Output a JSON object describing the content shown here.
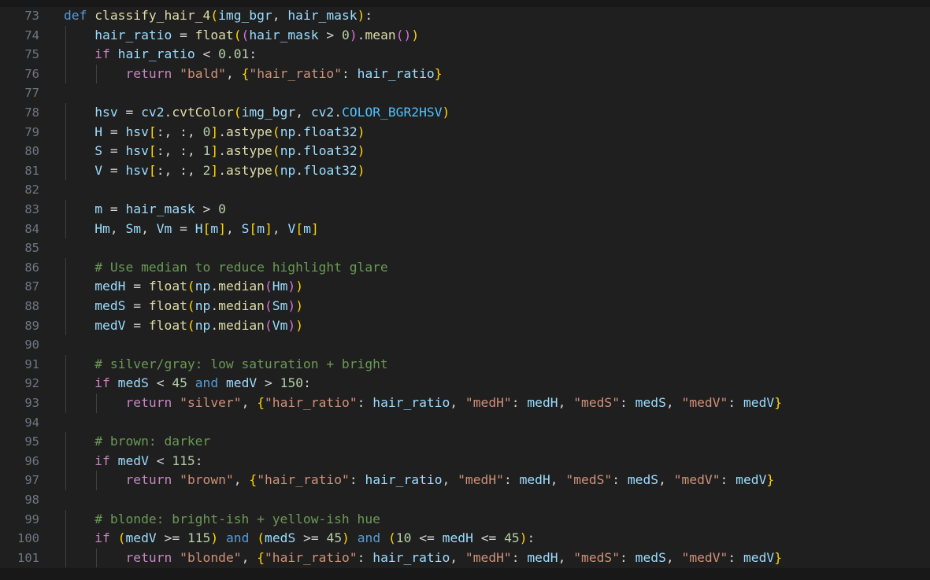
{
  "colors": {
    "background": "#1f1f1f",
    "line_number": "#6e7681",
    "keyword": "#569cd6",
    "control": "#c586c0",
    "function": "#dcdcaa",
    "variable": "#9cdcfe",
    "string": "#ce9178",
    "number": "#b5cea8",
    "comment": "#6a9955",
    "class": "#4ec9b0",
    "bracket_1": "#ffd700",
    "bracket_2": "#da70d6",
    "bracket_3": "#179fff"
  },
  "lines": [
    {
      "num": "73",
      "text": "def classify_hair_4(img_bgr, hair_mask):"
    },
    {
      "num": "74",
      "text": "    hair_ratio = float((hair_mask > 0).mean())"
    },
    {
      "num": "75",
      "text": "    if hair_ratio < 0.01:"
    },
    {
      "num": "76",
      "text": "        return \"bald\", {\"hair_ratio\": hair_ratio}"
    },
    {
      "num": "77",
      "text": ""
    },
    {
      "num": "78",
      "text": "    hsv = cv2.cvtColor(img_bgr, cv2.COLOR_BGR2HSV)"
    },
    {
      "num": "79",
      "text": "    H = hsv[:, :, 0].astype(np.float32)"
    },
    {
      "num": "80",
      "text": "    S = hsv[:, :, 1].astype(np.float32)"
    },
    {
      "num": "81",
      "text": "    V = hsv[:, :, 2].astype(np.float32)"
    },
    {
      "num": "82",
      "text": ""
    },
    {
      "num": "83",
      "text": "    m = hair_mask > 0"
    },
    {
      "num": "84",
      "text": "    Hm, Sm, Vm = H[m], S[m], V[m]"
    },
    {
      "num": "85",
      "text": ""
    },
    {
      "num": "86",
      "text": "    # Use median to reduce highlight glare"
    },
    {
      "num": "87",
      "text": "    medH = float(np.median(Hm))"
    },
    {
      "num": "88",
      "text": "    medS = float(np.median(Sm))"
    },
    {
      "num": "89",
      "text": "    medV = float(np.median(Vm))"
    },
    {
      "num": "90",
      "text": ""
    },
    {
      "num": "91",
      "text": "    # silver/gray: low saturation + bright"
    },
    {
      "num": "92",
      "text": "    if medS < 45 and medV > 150:"
    },
    {
      "num": "93",
      "text": "        return \"silver\", {\"hair_ratio\": hair_ratio, \"medH\": medH, \"medS\": medS, \"medV\": medV}"
    },
    {
      "num": "94",
      "text": ""
    },
    {
      "num": "95",
      "text": "    # brown: darker"
    },
    {
      "num": "96",
      "text": "    if medV < 115:"
    },
    {
      "num": "97",
      "text": "        return \"brown\", {\"hair_ratio\": hair_ratio, \"medH\": medH, \"medS\": medS, \"medV\": medV}"
    },
    {
      "num": "98",
      "text": ""
    },
    {
      "num": "99",
      "text": "    # blonde: bright-ish + yellow-ish hue"
    },
    {
      "num": "100",
      "text": "    if (medV >= 115) and (medS >= 45) and (10 <= medH <= 45):"
    },
    {
      "num": "101",
      "text": "        return \"blonde\", {\"hair_ratio\": hair_ratio, \"medH\": medH, \"medS\": medS, \"medV\": medV}"
    }
  ]
}
